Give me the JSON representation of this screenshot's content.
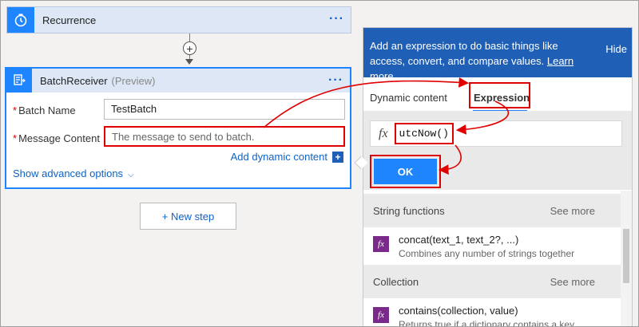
{
  "recurrence": {
    "title": "Recurrence",
    "menu": "···"
  },
  "batch": {
    "title": "BatchReceiver",
    "preview": "(Preview)",
    "menu": "···",
    "fields": [
      {
        "label": "Batch Name",
        "value": "TestBatch"
      },
      {
        "label": "Message Content",
        "placeholder": "The message to send to batch."
      }
    ],
    "required_mark": "*",
    "add_dynamic": "Add dynamic content",
    "add_icon": "+",
    "advanced": "Show advanced options",
    "advanced_icon": "⌵"
  },
  "new_step": "+ New step",
  "connector_plus": "+",
  "panel": {
    "header_text": "Add an expression to do basic things like access, convert, and compare values.",
    "learn_more": "Learn more",
    "hide": "Hide",
    "tabs": [
      "Dynamic content",
      "Expression"
    ],
    "active_tab": "Expression",
    "fx_label": "fx",
    "expression_value": "utcNow()",
    "ok": "OK",
    "sections": [
      {
        "name": "String functions",
        "see_more": "See more",
        "func": {
          "name": "concat(text_1, text_2?, ...)",
          "desc": "Combines any number of strings together"
        }
      },
      {
        "name": "Collection",
        "see_more": "See more",
        "func": {
          "name": "contains(collection, value)",
          "desc": "Returns true if a dictionary contains a key,..."
        }
      }
    ]
  },
  "colors": {
    "accent": "#1f85ff",
    "header_blue": "#1f5fb5",
    "highlight_red": "#e00000",
    "function_purple": "#7a2a8a"
  }
}
